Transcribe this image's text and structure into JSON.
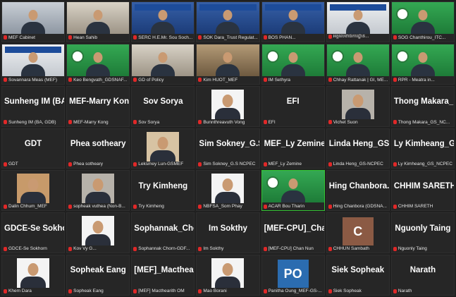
{
  "colors": {
    "background": "#1b1b1b",
    "tile": "#262626",
    "speaking_border": "#33c233",
    "mic_muted": "#e02828",
    "po_avatar": "#2b6cb0",
    "c_avatar": "#8b5a44"
  },
  "participants": [
    {
      "label": "MEF Cabinet",
      "center": "",
      "kind": "video",
      "bg": "bg-office"
    },
    {
      "label": "Hean Sahib",
      "center": "",
      "kind": "video",
      "bg": "bg-room"
    },
    {
      "label": "SERC H.E.Mr. Sou Soch...",
      "center": "",
      "kind": "video",
      "bg": "bg-blue"
    },
    {
      "label": "SOK Dara_Trust Regulat...",
      "center": "",
      "kind": "video",
      "bg": "bg-blue"
    },
    {
      "label": "BOS PHAN...",
      "center": "",
      "kind": "video",
      "bg": "bg-blue"
    },
    {
      "label": "អគ្គលេខាធិការដ្ឋាន...",
      "center": "",
      "kind": "video",
      "bg": "bg-light"
    },
    {
      "label": "SOG Chanthirou_ITC...",
      "center": "",
      "kind": "video",
      "bg": "bg-green"
    },
    {
      "label": "Sovannara Meas (MEF)",
      "center": "",
      "kind": "video",
      "bg": "bg-light"
    },
    {
      "label": "Keo Bengvath_GDSNAF...",
      "center": "",
      "kind": "video",
      "bg": "bg-green"
    },
    {
      "label": "GD of Policy",
      "center": "",
      "kind": "video",
      "bg": "bg-room"
    },
    {
      "label": "Kim HUOT_MEF",
      "center": "",
      "kind": "video",
      "bg": "bg-shelf"
    },
    {
      "label": "IM Sethyra",
      "center": "",
      "kind": "video",
      "bg": "bg-green"
    },
    {
      "label": "Chhay Rattanak | GI, ME...",
      "center": "",
      "kind": "video",
      "bg": "bg-green"
    },
    {
      "label": "RPR - Meatra in...",
      "center": "",
      "kind": "video",
      "bg": "bg-green"
    },
    {
      "label": "Sunheng IM (BA, GDB)",
      "center": "Sunheng IM (BA...",
      "kind": "name"
    },
    {
      "label": "MEF-Marry Kong",
      "center": "MEF-Marry Kong",
      "kind": "name"
    },
    {
      "label": "Sov Sorya",
      "center": "Sov Sorya",
      "kind": "name"
    },
    {
      "label": "Bunnthreavuth Vong",
      "center": "",
      "kind": "photo",
      "photo": "white"
    },
    {
      "label": "EFI",
      "center": "EFI",
      "kind": "name"
    },
    {
      "label": "Vichet Suon",
      "center": "",
      "kind": "photo",
      "photo": "grey"
    },
    {
      "label": "Thong Makara_GS_NC...",
      "center": "Thong Makara_...",
      "kind": "name"
    },
    {
      "label": "GDT",
      "center": "GDT",
      "kind": "name"
    },
    {
      "label": "Phea sotheary",
      "center": "Phea sotheary",
      "kind": "name"
    },
    {
      "label": "Leksmey Lun-GSMEF",
      "center": "",
      "kind": "photo",
      "photo": "tan"
    },
    {
      "label": "Sim Sokney_G.S NCPEC",
      "center": "Sim Sokney_G.S...",
      "kind": "name"
    },
    {
      "label": "MEF_Ly Zemine",
      "center": "MEF_Ly Zemine",
      "kind": "name"
    },
    {
      "label": "Linda Heng_GS-NCPEC",
      "center": "Linda Heng_GS-...",
      "kind": "name"
    },
    {
      "label": "Ly Kimheang_GS_NCPEC",
      "center": "Ly Kimheang_G...",
      "kind": "name"
    },
    {
      "label": "Dalin Chhum_MEF",
      "center": "",
      "kind": "photo",
      "photo": "warm"
    },
    {
      "label": "sopheak vuthea (Non-B...",
      "center": "",
      "kind": "photo",
      "photo": "grey"
    },
    {
      "label": "Try Kimheng",
      "center": "Try Kimheng",
      "kind": "name"
    },
    {
      "label": "NBFSA_Som Phay",
      "center": "",
      "kind": "photo",
      "photo": "white"
    },
    {
      "label": "ACAR Bou Tharin",
      "center": "",
      "kind": "video",
      "bg": "bg-green",
      "speaking": true
    },
    {
      "label": "Hing Chanbora (GDSNA...",
      "center": "Hing Chanbora...",
      "kind": "name"
    },
    {
      "label": "CHHIM SARETH",
      "center": "CHHIM SARETH",
      "kind": "name"
    },
    {
      "label": "GDCE-Se Sokhorn",
      "center": "GDCE-Se Sokhorn",
      "kind": "name"
    },
    {
      "label": "Kov Vy G...",
      "center": "",
      "kind": "photo",
      "photo": "white"
    },
    {
      "label": "Sophannak Chorn-GDF...",
      "center": "Sophannak_Cho...",
      "kind": "name"
    },
    {
      "label": "Im Sokthy",
      "center": "Im Sokthy",
      "kind": "name"
    },
    {
      "label": "[MEF-CPU] Chan Nun",
      "center": "[MEF-CPU]_Cha...",
      "kind": "name"
    },
    {
      "label": "CHHUN Sambath",
      "center": "",
      "kind": "letter",
      "letter": "C",
      "color": "#8b5a44"
    },
    {
      "label": "Nguonly Taing",
      "center": "Nguonly Taing",
      "kind": "name"
    },
    {
      "label": "Khem Dara",
      "center": "",
      "kind": "photo",
      "photo": "white"
    },
    {
      "label": "Sopheak Eang",
      "center": "Sopheak Eang",
      "kind": "name"
    },
    {
      "label": "[MEF] Macthearith OM",
      "center": "[MEF]_Macthear...",
      "kind": "name"
    },
    {
      "label": "Mao Borani",
      "center": "",
      "kind": "photo",
      "photo": "white"
    },
    {
      "label": "Panitha Oung_MEF-GS-...",
      "center": "",
      "kind": "letter",
      "letter": "PO",
      "color": "#2b6cb0"
    },
    {
      "label": "Siek Sopheak",
      "center": "Siek Sopheak",
      "kind": "name"
    },
    {
      "label": "Narath",
      "center": "Narath",
      "kind": "name"
    }
  ]
}
